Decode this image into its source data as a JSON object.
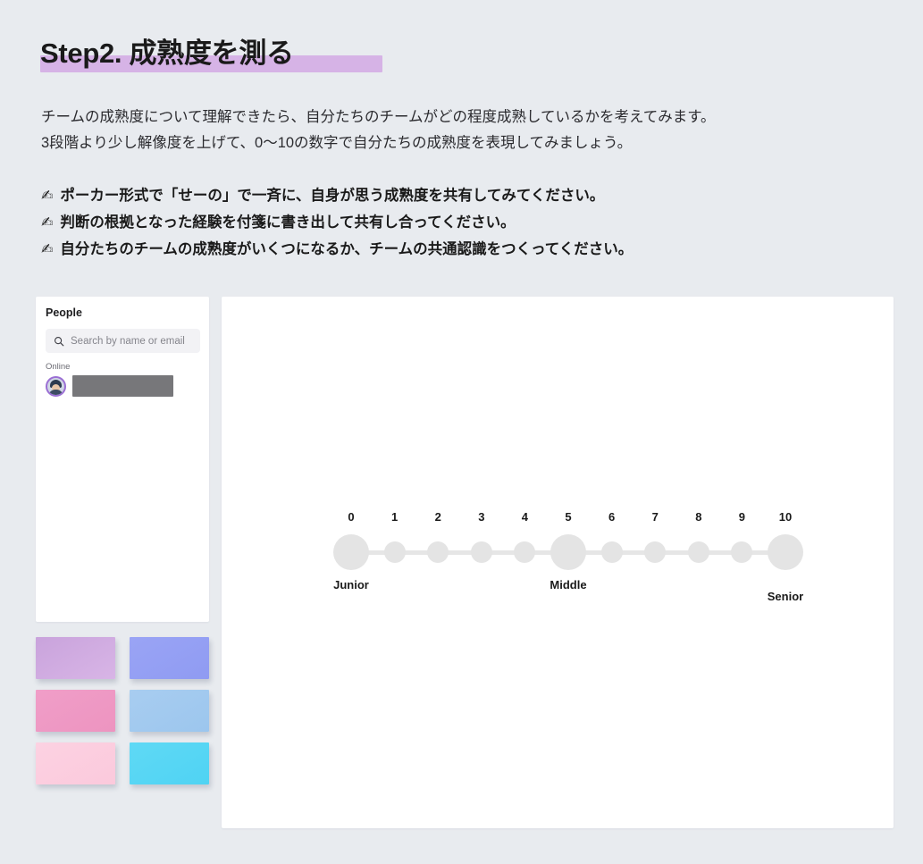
{
  "page": {
    "background_color": "#e8ebef",
    "title": "Step2. 成熟度を測る",
    "title_highlight_color": "#d6b3e6",
    "intro_lines": [
      "チームの成熟度について理解できたら、自分たちのチームがどの程度成熟しているかを考えてみます。",
      "3段階より少し解像度を上げて、0〜10の数字で自分たちの成熟度を表現してみましょう。"
    ],
    "bullets": [
      {
        "icon": "✍",
        "icon_name": "writing-hand-icon",
        "text": "ポーカー形式で「せーの」で一斉に、自身が思う成熟度を共有してみてください。"
      },
      {
        "icon": "✍",
        "icon_name": "writing-hand-icon",
        "text": "判断の根拠となった経験を付箋に書き出して共有し合ってください。"
      },
      {
        "icon": "✍",
        "icon_name": "writing-hand-icon",
        "text": "自分たちのチームの成熟度がいくつになるか、チームの共通認識をつくってください。"
      }
    ]
  },
  "people_panel": {
    "title": "People",
    "search": {
      "icon": "search-icon",
      "placeholder": "Search by name or email",
      "value": ""
    },
    "section_label": "Online",
    "members": [
      {
        "avatar": "user-avatar",
        "name": "",
        "redacted": true
      }
    ]
  },
  "sticky_palette": {
    "notes": [
      {
        "name": "sticky-note-purple",
        "color": "#c9a3dc",
        "gradient_end": "#d8b5e6"
      },
      {
        "name": "sticky-note-periwinkle",
        "color": "#9aa4f5",
        "gradient_end": "#8f9bf2"
      },
      {
        "name": "sticky-note-pink",
        "color": "#f09ec8",
        "gradient_end": "#ed94c0"
      },
      {
        "name": "sticky-note-lightblue",
        "color": "#a8cdf0",
        "gradient_end": "#9cc6ee"
      },
      {
        "name": "sticky-note-lightpink",
        "color": "#fcd2e2",
        "gradient_end": "#fbc9dc"
      },
      {
        "name": "sticky-note-cyan",
        "color": "#5fd9f5",
        "gradient_end": "#4fd3f3"
      }
    ]
  },
  "scale_widget": {
    "track_color": "#e6e6e6",
    "dot_color": "#e4e4e4",
    "stops": [
      {
        "number": "0",
        "caption": "Junior",
        "size": "major",
        "caption_position": "high"
      },
      {
        "number": "1",
        "caption": "",
        "size": "minor",
        "caption_position": "high"
      },
      {
        "number": "2",
        "caption": "",
        "size": "minor",
        "caption_position": "high"
      },
      {
        "number": "3",
        "caption": "",
        "size": "minor",
        "caption_position": "high"
      },
      {
        "number": "4",
        "caption": "",
        "size": "minor",
        "caption_position": "high"
      },
      {
        "number": "5",
        "caption": "Middle",
        "size": "major",
        "caption_position": "high"
      },
      {
        "number": "6",
        "caption": "",
        "size": "minor",
        "caption_position": "high"
      },
      {
        "number": "7",
        "caption": "",
        "size": "minor",
        "caption_position": "high"
      },
      {
        "number": "8",
        "caption": "",
        "size": "minor",
        "caption_position": "high"
      },
      {
        "number": "9",
        "caption": "",
        "size": "minor",
        "caption_position": "high"
      },
      {
        "number": "10",
        "caption": "Senior",
        "size": "major",
        "caption_position": "low"
      }
    ]
  }
}
